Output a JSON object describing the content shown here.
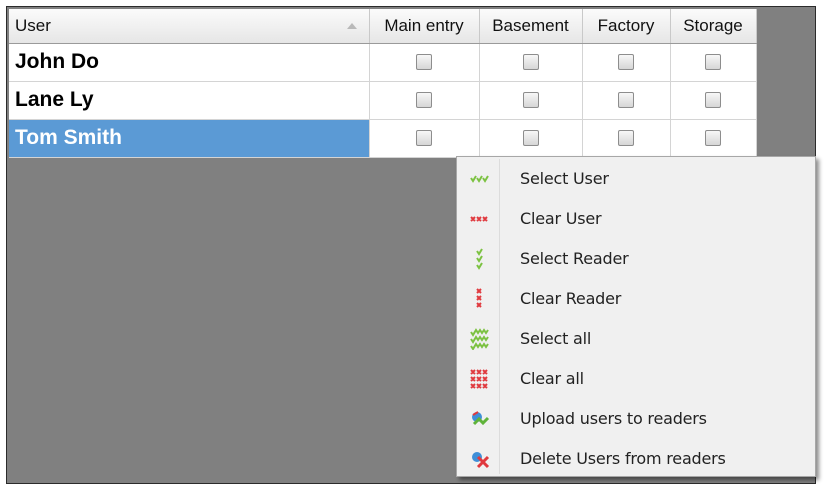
{
  "grid": {
    "columns": {
      "user": "User",
      "c1": "Main entry",
      "c2": "Basement",
      "c3": "Factory",
      "c4": "Storage"
    },
    "rows": [
      {
        "name": "John Do",
        "selected": false
      },
      {
        "name": "Lane Ly",
        "selected": false
      },
      {
        "name": "Tom Smith",
        "selected": true
      }
    ],
    "selection_color": "#5b9ad5"
  },
  "context_menu": {
    "items": [
      {
        "label": "Select User",
        "icon": "select-user-icon"
      },
      {
        "label": "Clear User",
        "icon": "clear-user-icon"
      },
      {
        "label": "Select Reader",
        "icon": "select-reader-icon"
      },
      {
        "label": "Clear Reader",
        "icon": "clear-reader-icon"
      },
      {
        "label": "Select all",
        "icon": "select-all-icon"
      },
      {
        "label": "Clear all",
        "icon": "clear-all-icon"
      },
      {
        "label": "Upload users to readers",
        "icon": "upload-users-icon"
      },
      {
        "label": "Delete Users from readers",
        "icon": "delete-users-icon"
      }
    ]
  }
}
